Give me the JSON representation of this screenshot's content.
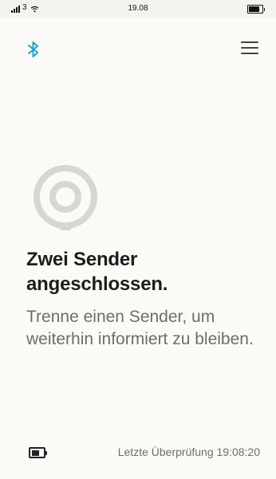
{
  "status_bar": {
    "carrier": "3",
    "time": "19.08",
    "battery_level": 0.85
  },
  "header": {
    "bluetooth_icon": "bluetooth-icon",
    "menu_icon": "hamburger-menu-icon"
  },
  "illustration": {
    "icon": "sensor-ring-icon",
    "color": "#d6d6d4"
  },
  "message": {
    "headline": "Zwei Sender angeschlossen.",
    "body": "Trenne einen Sender, um weiterhin informiert zu bleiben."
  },
  "footer": {
    "battery_icon": "battery-icon",
    "battery_level": 0.7,
    "last_check": "Letzte Überprüfung  19:08:20"
  },
  "colors": {
    "accent": "#1ea7c6",
    "background": "#fbfaf7",
    "headline": "#1d1d1d",
    "body_text": "#6d6d6d"
  }
}
